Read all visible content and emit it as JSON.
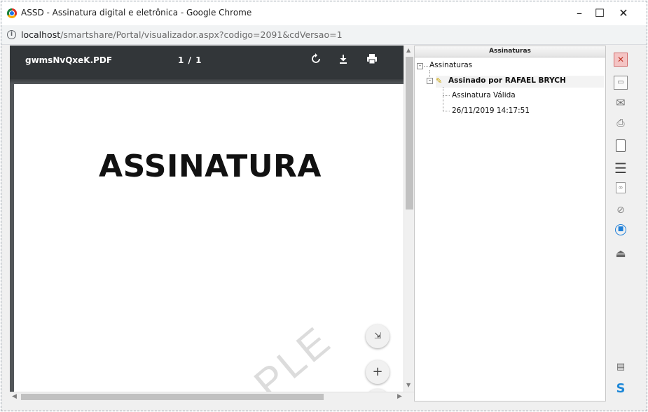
{
  "window": {
    "title": "ASSD - Assinatura digital e eletrônica - Google Chrome",
    "minimize_glyph": "–",
    "maximize_glyph": "☐",
    "close_glyph": "✕"
  },
  "address": {
    "host": "localhost",
    "path": "/smartshare/Portal/visualizador.aspx?codigo=2091&cdVersao=1"
  },
  "pdf": {
    "file_name": "gwmsNvQxeK.PDF",
    "page_indicator": "1 / 1",
    "heading": "ASSINATURA",
    "watermark": "PLE",
    "icons": [
      "rotate-icon",
      "download-icon",
      "print-icon"
    ],
    "zoom_buttons": {
      "fit": "⇲",
      "plus": "+",
      "minus": "−"
    }
  },
  "signatures": {
    "header": "Assinaturas",
    "root": "Assinaturas",
    "signer": "Assinado por RAFAEL BRYCH",
    "status": "Assinatura Válida",
    "datetime": "26/11/2019 14:17:51"
  },
  "right_toolbar": {
    "icons": [
      "close-icon",
      "save-icon",
      "mail-icon",
      "print-icon",
      "page-icon",
      "list-icon",
      "document-icon",
      "verify-icon",
      "lock-icon",
      "stamp-icon",
      "comment-icon",
      "logo-icon"
    ]
  },
  "colors": {
    "pdf_toolbar": "#323639",
    "viewer_bg": "#525659",
    "accent_blue": "#1e88d8"
  }
}
